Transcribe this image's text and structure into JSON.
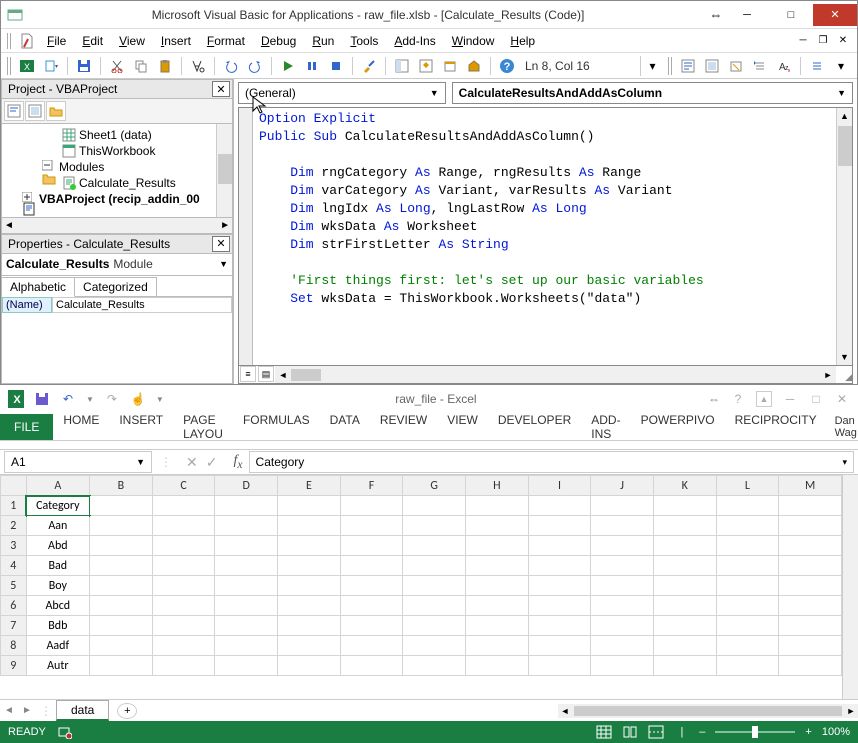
{
  "vba": {
    "title": "Microsoft Visual Basic for Applications - raw_file.xlsb - [Calculate_Results (Code)]",
    "menus": [
      "File",
      "Edit",
      "View",
      "Insert",
      "Format",
      "Debug",
      "Run",
      "Tools",
      "Add-Ins",
      "Window",
      "Help"
    ],
    "toolbar_status": "Ln 8, Col 16",
    "project": {
      "panel_title": "Project - VBAProject",
      "items": [
        {
          "indent": 60,
          "icon": "sheet",
          "label": "Sheet1 (data)"
        },
        {
          "indent": 60,
          "icon": "book",
          "label": "ThisWorkbook"
        },
        {
          "indent": 40,
          "icon": "folder-minus",
          "label": "Modules"
        },
        {
          "indent": 60,
          "icon": "module",
          "label": "Calculate_Results"
        },
        {
          "indent": 20,
          "icon": "vba-bold",
          "label": "VBAProject (recip_addin_00",
          "bold": true
        }
      ]
    },
    "properties": {
      "panel_title": "Properties - Calculate_Results",
      "object_name": "Calculate_Results",
      "object_type": "Module",
      "tabs": [
        "Alphabetic",
        "Categorized"
      ],
      "rows": [
        {
          "key": "(Name)",
          "value": "Calculate_Results"
        }
      ]
    },
    "code": {
      "object_combo": "(General)",
      "proc_combo": "CalculateResultsAndAddAsColumn",
      "lines": [
        [
          {
            "t": "Option Explicit",
            "c": "kw"
          }
        ],
        [
          {
            "t": "Public Sub ",
            "c": "kw"
          },
          {
            "t": "CalculateResultsAndAddAsColumn()",
            "c": ""
          }
        ],
        [],
        [
          {
            "t": "    Dim ",
            "c": "kw"
          },
          {
            "t": "rngCategory ",
            "c": ""
          },
          {
            "t": "As ",
            "c": "kw"
          },
          {
            "t": "Range, rngResults ",
            "c": ""
          },
          {
            "t": "As ",
            "c": "kw"
          },
          {
            "t": "Range",
            "c": ""
          }
        ],
        [
          {
            "t": "    Dim ",
            "c": "kw"
          },
          {
            "t": "varCategory ",
            "c": ""
          },
          {
            "t": "As ",
            "c": "kw"
          },
          {
            "t": "Variant, varResults ",
            "c": ""
          },
          {
            "t": "As ",
            "c": "kw"
          },
          {
            "t": "Variant",
            "c": ""
          }
        ],
        [
          {
            "t": "    Dim ",
            "c": "kw"
          },
          {
            "t": "lngIdx ",
            "c": ""
          },
          {
            "t": "As Long",
            "c": "kw"
          },
          {
            "t": ", lngLastRow ",
            "c": ""
          },
          {
            "t": "As Long",
            "c": "kw"
          }
        ],
        [
          {
            "t": "    Dim ",
            "c": "kw"
          },
          {
            "t": "wksData ",
            "c": ""
          },
          {
            "t": "As ",
            "c": "kw"
          },
          {
            "t": "Worksheet",
            "c": ""
          }
        ],
        [
          {
            "t": "    Dim ",
            "c": "kw"
          },
          {
            "t": "strFirstLetter ",
            "c": ""
          },
          {
            "t": "As String",
            "c": "kw"
          }
        ],
        [],
        [
          {
            "t": "    'First things first: let's set up our basic variables",
            "c": "cm"
          }
        ],
        [
          {
            "t": "    Set ",
            "c": "kw"
          },
          {
            "t": "wksData = ThisWorkbook.Worksheets(\"data\")",
            "c": ""
          }
        ]
      ]
    }
  },
  "excel": {
    "title": "raw_file - Excel",
    "ribbon_tabs": [
      "HOME",
      "INSERT",
      "PAGE LAYOU",
      "FORMULAS",
      "DATA",
      "REVIEW",
      "VIEW",
      "DEVELOPER",
      "ADD-INS",
      "POWERPIVO",
      "RECIPROCITY"
    ],
    "file_tab": "FILE",
    "user": "Dan Wag…",
    "name_box": "A1",
    "formula_bar": "Category",
    "columns": [
      "A",
      "B",
      "C",
      "D",
      "E",
      "F",
      "G",
      "H",
      "I",
      "J",
      "K",
      "L",
      "M"
    ],
    "rows": [
      {
        "n": 1,
        "A": "Category"
      },
      {
        "n": 2,
        "A": "Aan"
      },
      {
        "n": 3,
        "A": "Abd"
      },
      {
        "n": 4,
        "A": "Bad"
      },
      {
        "n": 5,
        "A": "Boy"
      },
      {
        "n": 6,
        "A": "Abcd"
      },
      {
        "n": 7,
        "A": "Bdb"
      },
      {
        "n": 8,
        "A": "Aadf"
      },
      {
        "n": 9,
        "A": "Autr"
      }
    ],
    "sheet_tab": "data",
    "status": "READY",
    "zoom": "100%"
  }
}
